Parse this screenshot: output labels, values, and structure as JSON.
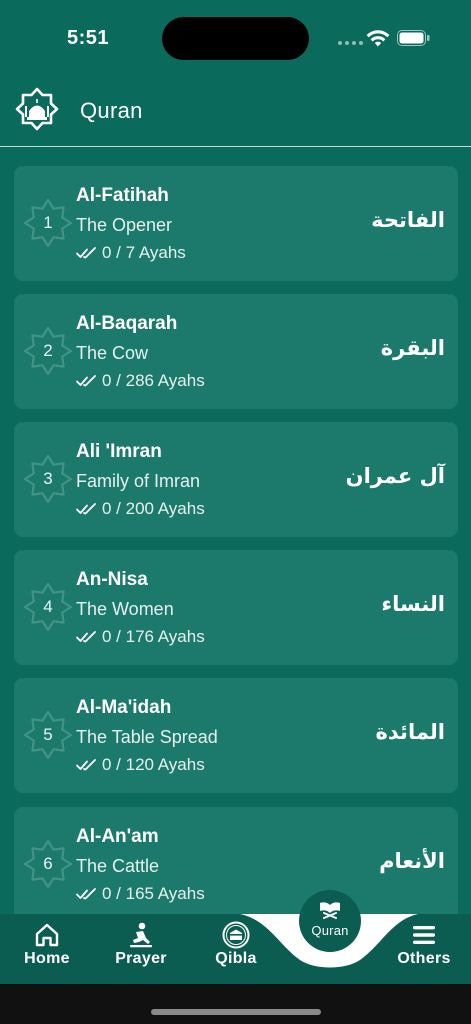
{
  "status_bar": {
    "time": "5:51",
    "icons": [
      "signal-dots-icon",
      "wifi-icon",
      "battery-icon"
    ]
  },
  "header": {
    "title": "Quran",
    "logo_icon": "mosque-logo-icon"
  },
  "colors": {
    "background": "#0a6b5c",
    "card": "#1b7a6c",
    "nav": "#0c5d51",
    "text": "#ffffff"
  },
  "surahs": [
    {
      "number": "1",
      "name": "Al-Fatihah",
      "meaning": "The Opener",
      "progress": "0 / 7 Ayahs",
      "arabic": "الفاتحة"
    },
    {
      "number": "2",
      "name": "Al-Baqarah",
      "meaning": "The Cow",
      "progress": "0 / 286 Ayahs",
      "arabic": "البقرة"
    },
    {
      "number": "3",
      "name": "Ali 'Imran",
      "meaning": "Family of Imran",
      "progress": "0 / 200 Ayahs",
      "arabic": "آل عمران"
    },
    {
      "number": "4",
      "name": "An-Nisa",
      "meaning": "The Women",
      "progress": "0 / 176 Ayahs",
      "arabic": "النساء"
    },
    {
      "number": "5",
      "name": "Al-Ma'idah",
      "meaning": "The Table Spread",
      "progress": "0 / 120 Ayahs",
      "arabic": "المائدة"
    },
    {
      "number": "6",
      "name": "Al-An'am",
      "meaning": "The Cattle",
      "progress": "0 / 165 Ayahs",
      "arabic": "الأنعام"
    }
  ],
  "bottom_nav": {
    "home": {
      "label": "Home",
      "icon": "home-icon"
    },
    "prayer": {
      "label": "Prayer",
      "icon": "prayer-icon"
    },
    "qibla": {
      "label": "Qibla",
      "icon": "kaaba-icon"
    },
    "quran": {
      "label": "Quran",
      "icon": "open-book-icon",
      "active": true
    },
    "others": {
      "label": "Others",
      "icon": "menu-icon"
    }
  }
}
